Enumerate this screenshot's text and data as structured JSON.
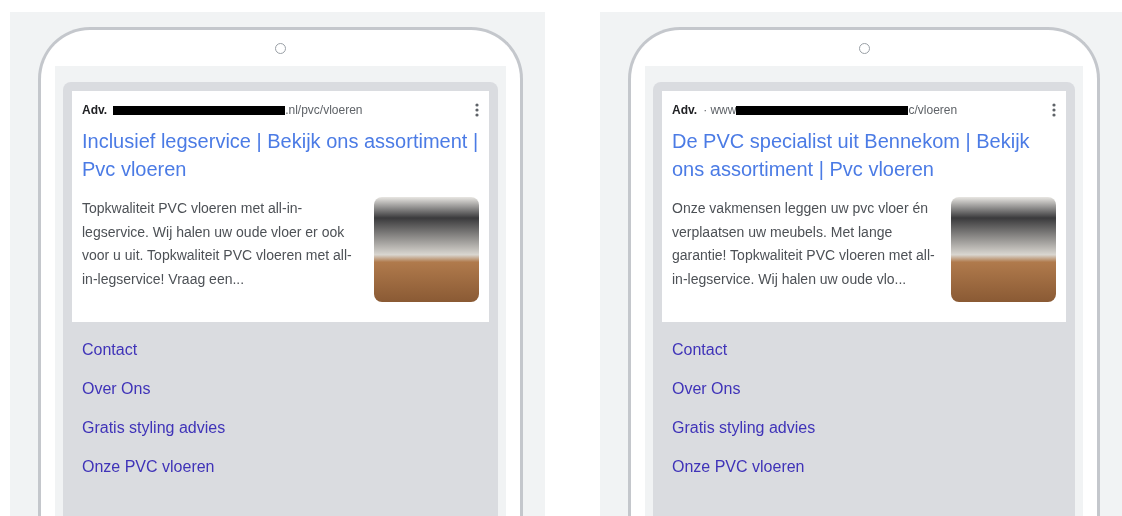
{
  "ads": [
    {
      "label": "Adv.",
      "url_suffix": ".nl/pvc/vloeren",
      "title": "Inclusief legservice | Bekijk ons assortiment | Pvc vloeren",
      "description": "Topkwaliteit PVC vloeren met all-in-legservice. Wij halen uw oude vloer er ook voor u uit. Topkwaliteit PVC vloeren met all-in-legservice! Vraag een...",
      "sitelinks": [
        "Contact",
        "Over Ons",
        "Gratis styling advies",
        "Onze PVC vloeren"
      ]
    },
    {
      "label": "Adv.",
      "url_prefix": "· www",
      "url_suffix": "c/vloeren",
      "title": "De PVC specialist uit Bennekom | Bekijk ons assortiment | Pvc vloeren",
      "description": "Onze vakmensen leggen uw pvc vloer én verplaatsen uw meubels. Met lange garantie! Topkwaliteit PVC vloeren met all-in-legservice. Wij halen uw oude vlo...",
      "sitelinks": [
        "Contact",
        "Over Ons",
        "Gratis styling advies",
        "Onze PVC vloeren"
      ]
    }
  ]
}
